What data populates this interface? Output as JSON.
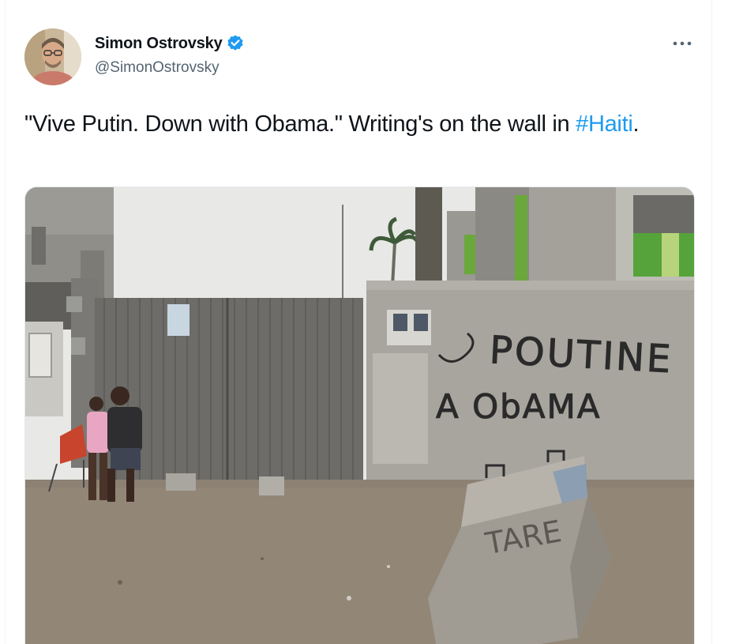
{
  "author": {
    "display_name": "Simon Ostrovsky",
    "handle": "@SimonOstrovsky",
    "verified": true
  },
  "tweet": {
    "text_before": "\"Vive Putin. Down with Obama.\" Writing's on the wall in ",
    "hashtag": "#Haiti",
    "text_after": "."
  },
  "photo": {
    "graffiti_line1": "POUTINE",
    "graffiti_line2": "A ObAMA",
    "barrier_scrawl": "TARE"
  },
  "icons": {
    "verified": "verified-badge-icon",
    "more": "more-options-icon"
  },
  "colors": {
    "accent": "#1d9bf0",
    "text": "#0f1419",
    "secondary": "#536471"
  }
}
